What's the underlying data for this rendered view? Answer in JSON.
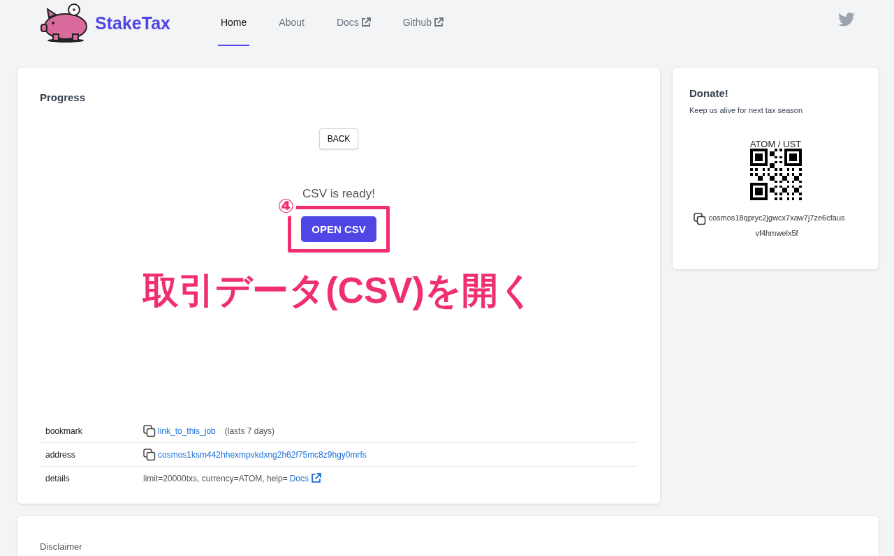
{
  "header": {
    "logo_text": "StakeTax",
    "nav": [
      {
        "label": "Home",
        "selected": true,
        "external": false
      },
      {
        "label": "About",
        "selected": false,
        "external": false
      },
      {
        "label": "Docs",
        "selected": false,
        "external": true
      },
      {
        "label": "Github",
        "selected": false,
        "external": true
      }
    ]
  },
  "progress": {
    "title": "Progress",
    "back_button": "BACK",
    "status": "CSV is ready!",
    "step_number": "④",
    "open_button": "OPEN CSV",
    "caption": "取引データ(CSV)を開く",
    "details": [
      {
        "label": "bookmark",
        "kind": "copy-link",
        "link": "link_to_this_job",
        "note": "(lasts 7 days)"
      },
      {
        "label": "address",
        "kind": "copy-link",
        "link": "cosmos1ksm442hhexmpvkdxng2h62f75mc8z9hgy0mrfs"
      },
      {
        "label": "details",
        "kind": "text-link",
        "text": "limit=20000txs, currency=ATOM, help=",
        "link": "Docs"
      }
    ]
  },
  "donate": {
    "title": "Donate!",
    "subtitle": "Keep us alive for next tax season",
    "qr_label": "ATOM / UST",
    "address": "cosmos18qpryc2jgwcx7xaw7j7ze6cfausvf4hmwelx5f"
  },
  "disclaimer": {
    "title": "Disclaimer"
  }
}
